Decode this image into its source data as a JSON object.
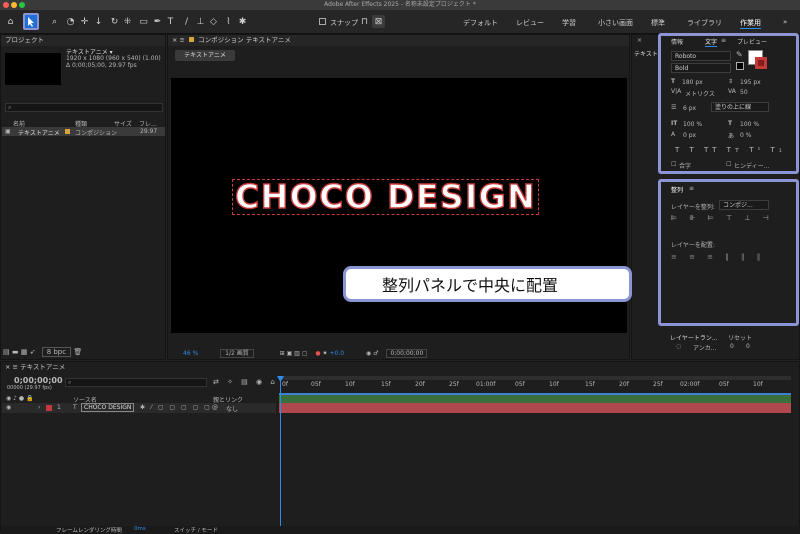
{
  "window": {
    "title": "Adobe After Effects 2025 - 名称未設定プロジェクト *"
  },
  "toolbar": {
    "snap_label": "スナップ",
    "workspaces": [
      "デフォルト",
      "レビュー",
      "学習",
      "小さい画面",
      "標準",
      "ライブラリ",
      "作業用"
    ]
  },
  "project": {
    "title": "プロジェクト",
    "item_name": "テキストアニメ ▾",
    "item_info1": "1920 x 1080 (960 x 540) (1.00)",
    "item_info2": "Δ 0;00;05;00, 29.97 fps",
    "search_placeholder": "",
    "col_name": "名前",
    "col_type": "種類",
    "col_size": "サイズ",
    "col_frame": "フレ...",
    "row_name": "テキストアニメ",
    "row_type": "コンポジション",
    "row_frame": "29.97",
    "bpc": "8 bpc"
  },
  "comp": {
    "header": "コンポジション テキストアニメ",
    "tab": "テキストアニメ",
    "text": "CHOCO DESIGN",
    "zoom": "46 %",
    "quality": "1/2 画質",
    "exposure": "+0.0",
    "timecode": "0;00;00;00"
  },
  "info_tabs": [
    "情報",
    "文字",
    "プレビュー"
  ],
  "character": {
    "font": "Roboto",
    "style": "Bold",
    "size": "180 px",
    "leading": "195 px",
    "kerning": "メトリクス",
    "tracking": "50",
    "stroke": "6 px",
    "stroke_mode": "塗りの上に線",
    "vscale": "100 %",
    "hscale": "100 %",
    "baseline": "0 px",
    "tsume": "0 %",
    "ligature": "合字",
    "hindi": "ヒンディー..."
  },
  "align": {
    "title": "整列",
    "align_to_label": "レイヤーを整列:",
    "align_to_value": "コンポジ...",
    "align_layers": "レイヤーを配置:"
  },
  "transform": {
    "title": "レイヤートラン...",
    "reset": "リセット",
    "anchor": "アンカ...",
    "anchor_x": "0",
    "anchor_y": "0"
  },
  "callout": "整列パネルで中央に配置",
  "timeline": {
    "tab": "テキストアニメ",
    "timecode": "0;00;00;00",
    "fps": "00000 (29.97 fps)",
    "col_source": "ソース名",
    "col_parent": "親とリンク",
    "layer_num": "1",
    "layer_name": "CHOCO DESIGN",
    "parent_value": "なし",
    "footer_left": "フレームレンダリング時間",
    "footer_ms": "0ms",
    "footer_switch": "スイッチ / モード",
    "ticks": [
      "0f",
      "05f",
      "10f",
      "15f",
      "20f",
      "25f",
      "01:00f",
      "05f",
      "10f",
      "15f",
      "20f",
      "25f",
      "02:00f",
      "05f",
      "10f"
    ]
  },
  "colors": {
    "accent": "#2d8ceb",
    "highlight": "#8c95d4",
    "layer_bar": "#b0494f",
    "label_red": "#c43a3a"
  }
}
